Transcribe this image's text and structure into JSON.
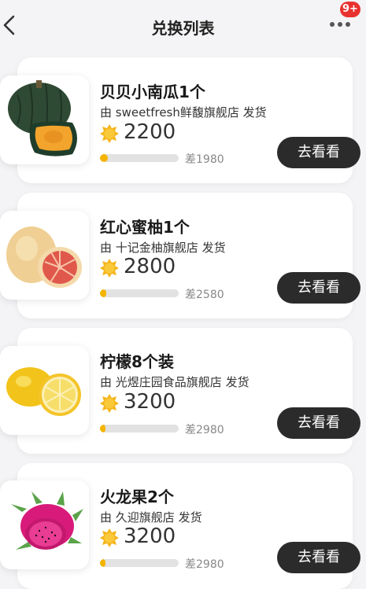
{
  "header": {
    "title": "兑换列表",
    "back_icon": "chevron-left-icon",
    "more_icon": "more-dots-icon",
    "badge": "9+"
  },
  "colors": {
    "progress_fill": "#f4b400",
    "button_bg": "#2b2b2b",
    "badge_bg": "#e8322f"
  },
  "items": [
    {
      "title": "贝贝小南瓜1个",
      "shop_prefix": "由 ",
      "shop_name": "sweetfresh鲜馥旗舰店",
      "shop_suffix": " 发货",
      "points": "2200",
      "points_icon": "gold-coin-icon",
      "progress": 0.1,
      "diff": "差1980",
      "button": "去看看",
      "image": "pumpkin"
    },
    {
      "title": "红心蜜柚1个",
      "shop_prefix": "由 ",
      "shop_name": "十记金柚旗舰店",
      "shop_suffix": " 发货",
      "points": "2800",
      "points_icon": "gold-coin-icon",
      "progress": 0.08,
      "diff": "差2580",
      "button": "去看看",
      "image": "pomelo"
    },
    {
      "title": "柠檬8个装",
      "shop_prefix": "由 ",
      "shop_name": "光煜庄园食品旗舰店",
      "shop_suffix": " 发货",
      "points": "3200",
      "points_icon": "gold-coin-icon",
      "progress": 0.07,
      "diff": "差2980",
      "button": "去看看",
      "image": "lemon"
    },
    {
      "title": "火龙果2个",
      "shop_prefix": "由 ",
      "shop_name": "久迎旗舰店",
      "shop_suffix": " 发货",
      "points": "3200",
      "points_icon": "gold-coin-icon",
      "progress": 0.07,
      "diff": "差2980",
      "button": "去看看",
      "image": "dragonfruit"
    }
  ]
}
